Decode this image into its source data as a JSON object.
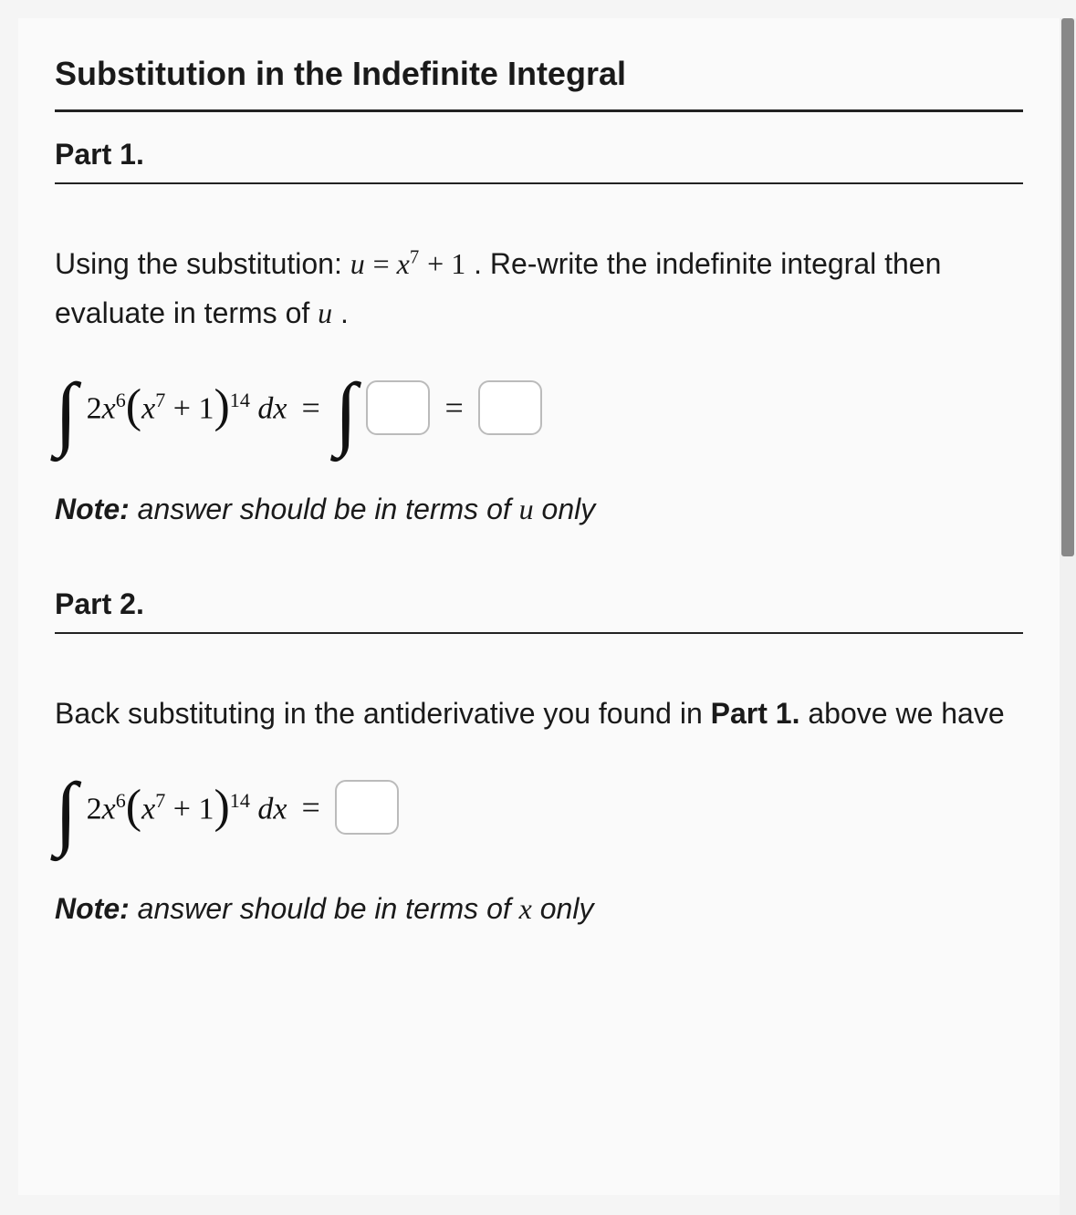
{
  "title": "Substitution in the Indefinite Integral",
  "part1": {
    "heading": "Part 1.",
    "sub_prefix": "Using the substitution: ",
    "sub_expr_lhs": "u",
    "sub_eq": " = ",
    "sub_expr_rhs_base": "x",
    "sub_expr_rhs_exp": "7",
    "sub_expr_rhs_tail": " + 1",
    "sub_suffix": ". Re-write the indefinite integral then evaluate in terms of ",
    "sub_suffix_var": "u",
    "sub_suffix_end": ".",
    "integrand_coeff": "2",
    "integrand_x": "x",
    "integrand_exp1": "6",
    "integrand_paren_x": "x",
    "integrand_paren_exp": "7",
    "integrand_plus1": " + 1",
    "integrand_outer_exp": "14",
    "integrand_dx": " dx",
    "equals": " = ",
    "note_label": "Note:",
    "note_body": " answer should be in terms of ",
    "note_var": "u",
    "note_end": " only"
  },
  "part2": {
    "heading": "Part 2.",
    "body_prefix": "Back substituting in the antiderivative you found in ",
    "body_bold": "Part 1.",
    "body_suffix": " above we have",
    "integrand_coeff": "2",
    "integrand_x": "x",
    "integrand_exp1": "6",
    "integrand_paren_x": "x",
    "integrand_paren_exp": "7",
    "integrand_plus1": " + 1",
    "integrand_outer_exp": "14",
    "integrand_dx": " dx",
    "equals": " = ",
    "note_label": "Note:",
    "note_body": " answer should be in terms of ",
    "note_var": "x",
    "note_end": " only"
  }
}
